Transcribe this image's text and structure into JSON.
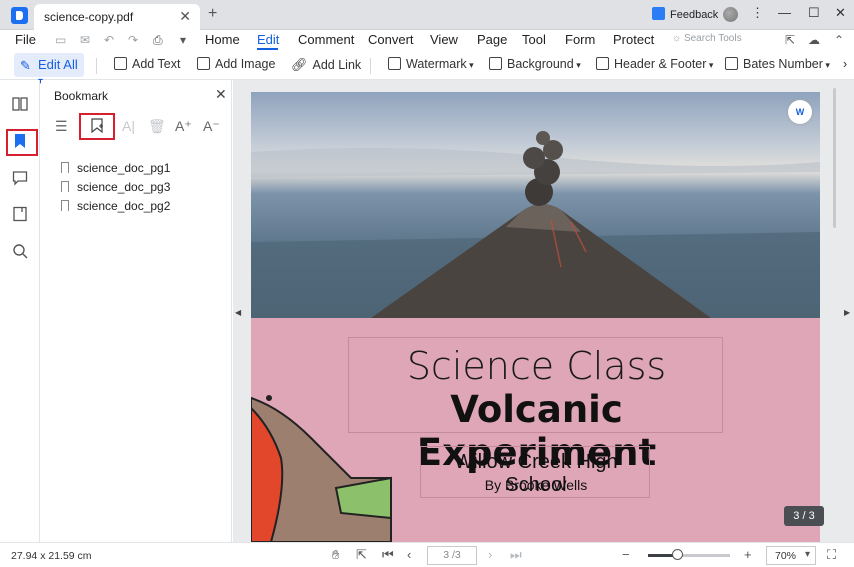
{
  "titlebar": {
    "tab_title": "science-copy.pdf",
    "tab_close": "✕",
    "tab_add": "+",
    "feedback": "Feedback",
    "window_controls": [
      "⋮",
      "—",
      "☐",
      "✕"
    ]
  },
  "menubar": {
    "file": "File",
    "items": [
      "Home",
      "Edit",
      "Comment",
      "Convert",
      "View",
      "Page",
      "Tool",
      "Form",
      "Protect"
    ],
    "active_item": "Edit",
    "search_tools": "Search Tools"
  },
  "toolbar": {
    "edit_all": "Edit All",
    "add_text": "Add Text",
    "add_image": "Add Image",
    "add_link": "Add Link",
    "watermark": "Watermark",
    "background": "Background",
    "header_footer": "Header & Footer",
    "bates_number": "Bates Number"
  },
  "bookmark_panel": {
    "title": "Bookmark",
    "close": "✕",
    "items": [
      "science_doc_pg1",
      "science_doc_pg3",
      "science_doc_pg2"
    ]
  },
  "document": {
    "title_line1": "Science Class",
    "title_line2": "Volcanic Experiment",
    "school": "Willow Creek High School",
    "author": "By Brooke Wells",
    "page_counter": "3 / 3",
    "convert_badge": "W"
  },
  "statusbar": {
    "dimensions": "27.94 x 21.59 cm",
    "page_input": "3 /3",
    "zoom": "70%",
    "zoom_level_fraction": 0.35
  },
  "colors": {
    "accent": "#1560e0",
    "highlight_box": "#d6202e",
    "slide_pink": "#dfa6b8"
  }
}
